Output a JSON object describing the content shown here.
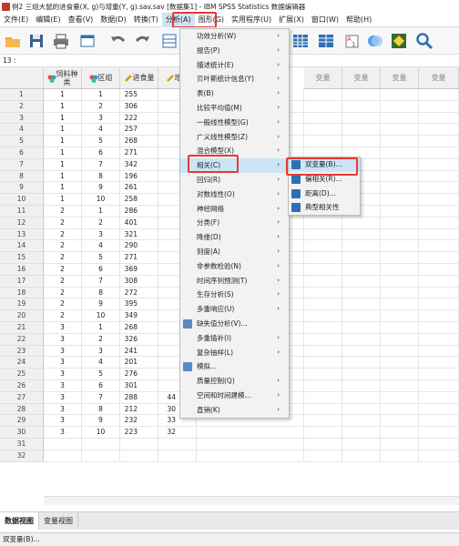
{
  "window": {
    "title": "例2 三组大鼠的进食量(X, g)与增重(Y, g).sav.sav [数据集1] - IBM SPSS Statistics 数据编辑器"
  },
  "menubar": {
    "items": [
      {
        "label": "文件(E)"
      },
      {
        "label": "编辑(E)"
      },
      {
        "label": "查看(V)"
      },
      {
        "label": "数据(D)"
      },
      {
        "label": "转换(T)"
      },
      {
        "label": "分析(A)"
      },
      {
        "label": "图形(G)"
      },
      {
        "label": "实用程序(U)"
      },
      {
        "label": "扩展(X)"
      },
      {
        "label": "窗口(W)"
      },
      {
        "label": "帮助(H)"
      }
    ],
    "active": "分析(A)"
  },
  "cellref": {
    "label": "13 :"
  },
  "grid": {
    "columns": [
      {
        "label": "饲料种类",
        "icon": "nominal-icon"
      },
      {
        "label": "区组",
        "icon": "nominal-icon"
      },
      {
        "label": "进食量",
        "icon": "scale-icon"
      },
      {
        "label": "增重",
        "icon": "scale-icon"
      }
    ],
    "empty_column_label": "变量",
    "rows": [
      [
        "1",
        "1",
        "255",
        ""
      ],
      [
        "1",
        "2",
        "306",
        ""
      ],
      [
        "1",
        "3",
        "222",
        ""
      ],
      [
        "1",
        "4",
        "257",
        ""
      ],
      [
        "1",
        "5",
        "268",
        ""
      ],
      [
        "1",
        "6",
        "271",
        ""
      ],
      [
        "1",
        "7",
        "342",
        ""
      ],
      [
        "1",
        "8",
        "196",
        ""
      ],
      [
        "1",
        "9",
        "261",
        ""
      ],
      [
        "1",
        "10",
        "258",
        ""
      ],
      [
        "2",
        "1",
        "286",
        ""
      ],
      [
        "2",
        "2",
        "401",
        ""
      ],
      [
        "2",
        "3",
        "321",
        ""
      ],
      [
        "2",
        "4",
        "290",
        ""
      ],
      [
        "2",
        "5",
        "271",
        ""
      ],
      [
        "2",
        "6",
        "369",
        ""
      ],
      [
        "2",
        "7",
        "308",
        ""
      ],
      [
        "2",
        "8",
        "272",
        ""
      ],
      [
        "2",
        "9",
        "395",
        ""
      ],
      [
        "2",
        "10",
        "349",
        ""
      ],
      [
        "3",
        "1",
        "268",
        ""
      ],
      [
        "3",
        "2",
        "326",
        ""
      ],
      [
        "3",
        "3",
        "241",
        ""
      ],
      [
        "3",
        "4",
        "201",
        ""
      ],
      [
        "3",
        "5",
        "276",
        ""
      ],
      [
        "3",
        "6",
        "301",
        ""
      ],
      [
        "3",
        "7",
        "288",
        "44"
      ],
      [
        "3",
        "8",
        "212",
        "30"
      ],
      [
        "3",
        "9",
        "232",
        "33"
      ],
      [
        "3",
        "10",
        "223",
        "32"
      ],
      [
        "",
        "",
        "",
        ""
      ],
      [
        "",
        "",
        "",
        ""
      ]
    ]
  },
  "analyze_menu": {
    "items": [
      {
        "label": "功效分析(W)",
        "submenu": true
      },
      {
        "label": "报告(P)",
        "submenu": true
      },
      {
        "label": "描述统计(E)",
        "submenu": true
      },
      {
        "label": "贝叶斯统计信息(Y)",
        "submenu": true
      },
      {
        "label": "表(B)",
        "submenu": true
      },
      {
        "label": "比较平均值(M)",
        "submenu": true
      },
      {
        "label": "一般线性模型(G)",
        "submenu": true
      },
      {
        "label": "广义线性模型(Z)",
        "submenu": true
      },
      {
        "label": "混合模型(X)",
        "submenu": true
      },
      {
        "label": "相关(C)",
        "submenu": true,
        "highlight": true
      },
      {
        "label": "回归(R)",
        "submenu": true
      },
      {
        "label": "对数线性(O)",
        "submenu": true
      },
      {
        "label": "神经网络",
        "submenu": true
      },
      {
        "label": "分类(F)",
        "submenu": true
      },
      {
        "label": "降维(D)",
        "submenu": true
      },
      {
        "label": "刻度(A)",
        "submenu": true
      },
      {
        "label": "非参数检验(N)",
        "submenu": true
      },
      {
        "label": "时间序列预测(T)",
        "submenu": true
      },
      {
        "label": "生存分析(S)",
        "submenu": true
      },
      {
        "label": "多重响应(U)",
        "submenu": true
      },
      {
        "label": "缺失值分析(V)...",
        "submenu": false,
        "icon": "missing-value-icon"
      },
      {
        "label": "多重插补(I)",
        "submenu": true
      },
      {
        "label": "复杂抽样(L)",
        "submenu": true
      },
      {
        "label": "模拟...",
        "submenu": false,
        "icon": "simulation-icon"
      },
      {
        "label": "质量控制(Q)",
        "submenu": true
      },
      {
        "label": "空间和时间建模...",
        "submenu": true
      },
      {
        "label": "直销(K)",
        "submenu": true
      }
    ]
  },
  "correlate_menu": {
    "items": [
      {
        "label": "双变量(B)...",
        "highlight": true,
        "icon": "bivariate-icon"
      },
      {
        "label": "偏相关(R)...",
        "icon": "partial-icon"
      },
      {
        "label": "距离(D)...",
        "icon": "distance-icon"
      },
      {
        "label": "典型相关性",
        "icon": "canonical-icon"
      }
    ]
  },
  "tabs": {
    "data_view": "数据视图",
    "variable_view": "变量视图"
  },
  "status": {
    "text": "双变量(B)..."
  },
  "colors": {
    "highlight": "#cde4f7",
    "annotation_red": "#e53935",
    "menu_bg": "#f2f2f2"
  }
}
